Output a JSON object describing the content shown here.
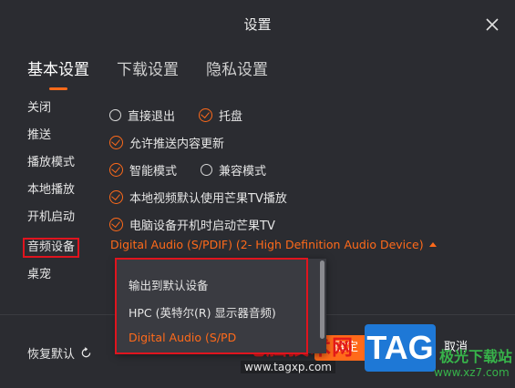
{
  "window": {
    "title": "设置"
  },
  "tabs": [
    {
      "label": "基本设置",
      "active": true
    },
    {
      "label": "下载设置",
      "active": false
    },
    {
      "label": "隐私设置",
      "active": false
    }
  ],
  "sidebar": {
    "items": [
      {
        "label": "关闭"
      },
      {
        "label": "推送"
      },
      {
        "label": "播放模式"
      },
      {
        "label": "本地播放"
      },
      {
        "label": "开机启动"
      },
      {
        "label": "音频设备"
      },
      {
        "label": "桌宠"
      }
    ]
  },
  "options": {
    "close_exit": {
      "label": "直接退出",
      "checked": false
    },
    "close_tray": {
      "label": "托盘",
      "checked": true
    },
    "push_update": {
      "label": "允许推送内容更新",
      "checked": true
    },
    "mode_smart": {
      "label": "智能模式",
      "checked": true
    },
    "mode_compat": {
      "label": "兼容模式",
      "checked": false
    },
    "local_default": {
      "label": "本地视频默认使用芒果TV播放",
      "checked": true
    },
    "autostart": {
      "label": "电脑设备开机时启动芒果TV",
      "checked": true
    }
  },
  "audio": {
    "selected": "Digital Audio (S/PDIF) (2- High Definition Audio Device)",
    "dropdown": [
      {
        "label": "输出到默认设备"
      },
      {
        "label": "HPC (英特尔(R) 显示器音频)"
      },
      {
        "label": "Digital Audio (S/PD"
      }
    ]
  },
  "footer": {
    "restore_label": "恢复默认",
    "confirm_label": "确定",
    "cancel_label": "取消"
  },
  "watermarks": {
    "site1_name": "电脑技术网",
    "site1_url": "www.tagxp.com",
    "logo_text": "TAG",
    "site2_name": "极光下载站",
    "site2_url": "www.xz7.com"
  },
  "colors": {
    "accent": "#ff6a1a",
    "highlight_border": "#e0141e",
    "background": "#2b2c31"
  }
}
